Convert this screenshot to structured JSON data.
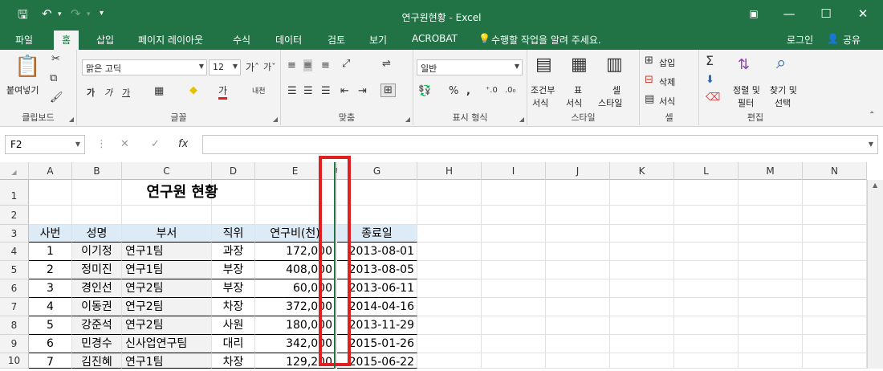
{
  "window": {
    "title": "연구원현황 - Excel"
  },
  "tabs": [
    "파일",
    "홈",
    "삽입",
    "페이지 레이아웃",
    "수식",
    "데이터",
    "검토",
    "보기",
    "ACROBAT"
  ],
  "tell_me": "수행할 작업을 알려 주세요.",
  "account": {
    "login": "로그인",
    "share": "공유"
  },
  "ribbon": {
    "clipboard": {
      "paste": "붙여넣기",
      "label": "클립보드"
    },
    "font": {
      "name": "맑은 고딕",
      "size": "12",
      "bold": "가",
      "italic": "가",
      "underline": "가",
      "phonetic": "내천",
      "label": "글꼴"
    },
    "alignment": {
      "label": "맞춤"
    },
    "number": {
      "format": "일반",
      "percent": "%",
      "comma": ",",
      "label": "표시 형식"
    },
    "styles": {
      "cond1": "조건부",
      "cond2": "서식",
      "table1": "표",
      "table2": "서식",
      "cell1": "셀",
      "cell2": "스타일",
      "label": "스타일"
    },
    "cells": {
      "insert": "삽입",
      "delete": "삭제",
      "format": "서식",
      "label": "셀"
    },
    "editing": {
      "sort1": "정렬 및",
      "sort2": "필터",
      "find1": "찾기 및",
      "find2": "선택",
      "label": "편집"
    }
  },
  "formula_bar": {
    "name_box": "F2",
    "cancel": "✕",
    "enter": "✓",
    "fx": "fx",
    "value": ""
  },
  "columns": [
    "A",
    "B",
    "C",
    "D",
    "E",
    "F",
    "G",
    "H",
    "I",
    "J",
    "K",
    "L",
    "M",
    "N"
  ],
  "rows": [
    "1",
    "2",
    "3",
    "4",
    "5",
    "6",
    "7",
    "8",
    "9",
    "10"
  ],
  "sheet": {
    "title": "연구원 현황",
    "headers": [
      "사번",
      "성명",
      "부서",
      "직위",
      "연구비(천)",
      "종료일"
    ],
    "records": [
      [
        "1",
        "이기정",
        "연구1팀",
        "과장",
        "172,000",
        "2013-08-01"
      ],
      [
        "2",
        "정미진",
        "연구1팀",
        "부장",
        "408,000",
        "2013-08-05"
      ],
      [
        "3",
        "경인선",
        "연구2팀",
        "부장",
        "60,000",
        "2013-06-11"
      ],
      [
        "4",
        "이동권",
        "연구2팀",
        "차장",
        "372,000",
        "2014-04-16"
      ],
      [
        "5",
        "강준석",
        "연구2팀",
        "사원",
        "180,000",
        "2013-11-29"
      ],
      [
        "6",
        "민경수",
        "신사업연구팀",
        "대리",
        "342,000",
        "2015-01-26"
      ],
      [
        "7",
        "김진혜",
        "연구1팀",
        "차장",
        "129,200",
        "2015-06-22"
      ]
    ]
  },
  "colors": {
    "excel_green": "#217346",
    "header_fill": "#ddebf7",
    "highlight_red": "#e02020"
  }
}
